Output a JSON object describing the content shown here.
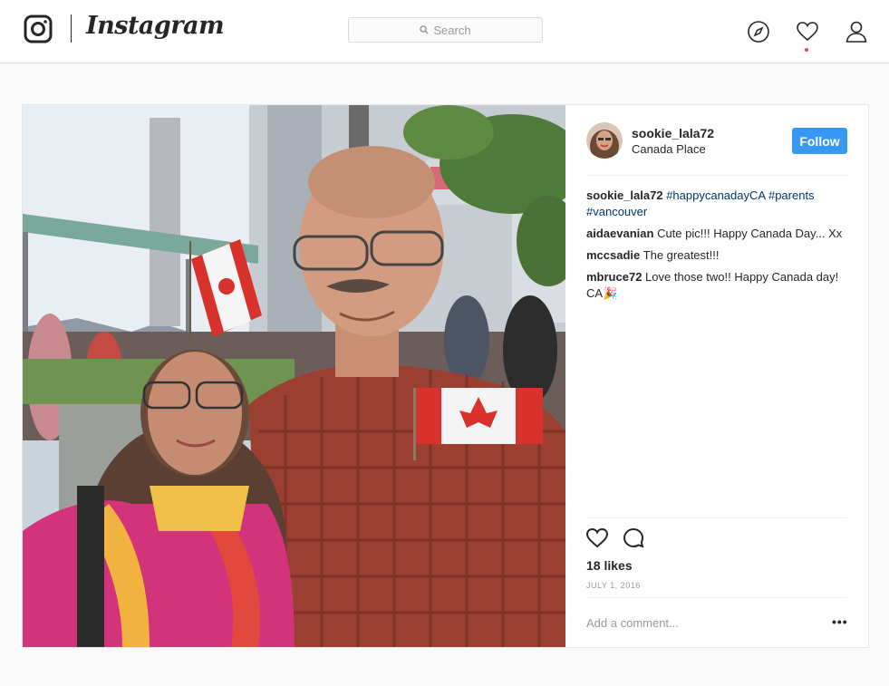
{
  "nav": {
    "brand": "Instagram",
    "search_placeholder": "Search",
    "icons": [
      "instagram-camera-icon",
      "search-icon",
      "compass-icon",
      "heart-icon",
      "profile-icon"
    ]
  },
  "post": {
    "photo_icon": "photo",
    "author": {
      "username": "sookie_lala72",
      "location": "Canada Place",
      "follow_label": "Follow"
    },
    "caption": {
      "user": "sookie_lala72",
      "tags": [
        "#happycanadayCA",
        "#parents",
        "#vancouver"
      ]
    },
    "comments": [
      {
        "user": "aidaevanian",
        "text": "Cute pic!!! Happy Canada Day... Xx"
      },
      {
        "user": "mccsadie",
        "text": "The greatest!!!"
      },
      {
        "user": "mbruce72",
        "text": "Love those two!! Happy Canada day! CA🎉"
      }
    ],
    "likes": "18 likes",
    "date": "JULY 1, 2016",
    "add_comment_placeholder": "Add a comment...",
    "more_label": "•••"
  },
  "colors": {
    "follow_blue": "#3897f0",
    "hashtag": "#003569",
    "notification_dot": "#ed4956"
  }
}
